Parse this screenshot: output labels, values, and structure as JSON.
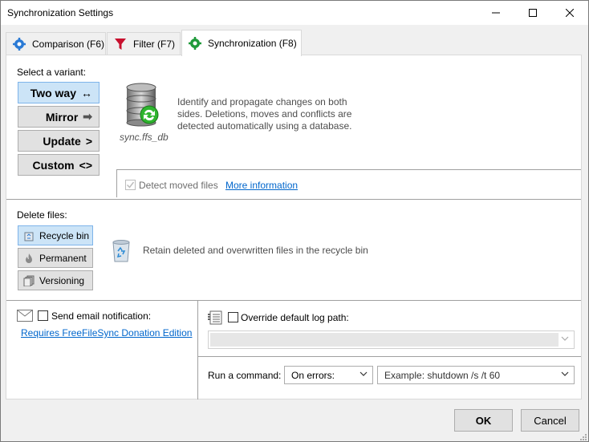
{
  "window": {
    "title": "Synchronization Settings",
    "minimize_icon": "minimize-icon",
    "maximize_icon": "maximize-icon",
    "close_icon": "close-icon"
  },
  "tabs": [
    {
      "label": "Comparison (F6)",
      "icon": "gear-blue-icon",
      "active": false
    },
    {
      "label": "Filter (F7)",
      "icon": "funnel-icon",
      "active": false
    },
    {
      "label": "Synchronization (F8)",
      "icon": "gear-green-icon",
      "active": true
    }
  ],
  "variant": {
    "heading": "Select a variant:",
    "buttons": [
      {
        "label": "Two way",
        "arrow": "↔",
        "selected": true
      },
      {
        "label": "Mirror",
        "arrow": "➡",
        "selected": false
      },
      {
        "label": "Update",
        "arrow": ">",
        "selected": false
      },
      {
        "label": "Custom",
        "arrow": "<>",
        "selected": false
      }
    ],
    "db_caption": "sync.ffs_db",
    "description": "Identify and propagate changes on both sides. Deletions, moves and conflicts are detected automatically using a database.",
    "detect_moved_label": "Detect moved files",
    "detect_moved_checked": true,
    "more_info_label": "More information"
  },
  "delete": {
    "heading": "Delete files:",
    "buttons": [
      {
        "label": "Recycle bin",
        "selected": true
      },
      {
        "label": "Permanent",
        "selected": false
      },
      {
        "label": "Versioning",
        "selected": false
      }
    ],
    "description": "Retain deleted and overwritten files in the recycle bin"
  },
  "email": {
    "label": "Send email notification:",
    "checked": false,
    "link": "Requires FreeFileSync Donation Edition"
  },
  "log": {
    "label": "Override default log path:",
    "checked": false,
    "path_value": ""
  },
  "command": {
    "label": "Run a command:",
    "when_value": "On errors:",
    "command_placeholder": "Example: shutdown /s /t 60"
  },
  "footer": {
    "ok_label": "OK",
    "cancel_label": "Cancel"
  },
  "colors": {
    "selected_bg": "#cce4f7",
    "selected_border": "#7eb4ea",
    "link": "#0066cc"
  }
}
